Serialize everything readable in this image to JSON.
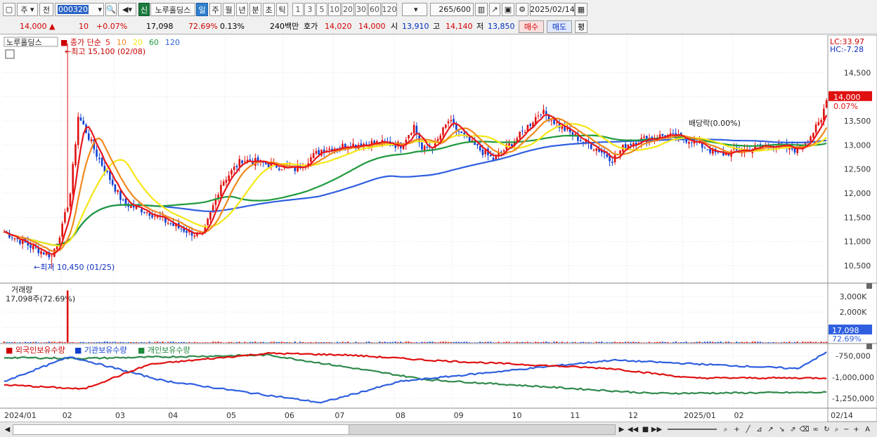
{
  "toolbar": {
    "market": "주",
    "type": "전",
    "code": "000320",
    "name": "노루홀딩스",
    "new_badge": "신",
    "periods": [
      "일",
      "주",
      "월",
      "년",
      "분",
      "초",
      "틱"
    ],
    "active_period": "일",
    "intervals": [
      "1",
      "3",
      "5",
      "10",
      "20",
      "30",
      "60",
      "120"
    ],
    "count": "265",
    "count_total": "/600",
    "date": "2025/02/14"
  },
  "quote": {
    "price": "14,000",
    "arrow": "▲",
    "change": "10",
    "change_pct": "+0.07%",
    "volume": "17,098",
    "volume_pct": "72.69%",
    "turnover_pct": "0.13%",
    "amount": "240백만",
    "ask_label": "호가",
    "ask1": "14,020",
    "ask2": "14,000",
    "open_label": "시",
    "open": "13,910",
    "high_label": "고",
    "high": "14,140",
    "low_label": "저",
    "low": "13,850",
    "buy_label": "매수",
    "sell_label": "매도",
    "eval_label": "평"
  },
  "legend": {
    "stock_name": "노루홀딩스",
    "series_label": "종가 단순",
    "ma_periods": [
      "5",
      "10",
      "20",
      "60",
      "120"
    ],
    "ma_colors": [
      "#e8171b",
      "#f08a1c",
      "#f5e616",
      "#1f9a3c",
      "#2f5fe0"
    ],
    "high_note": "←최고 15,100 (02/08)",
    "low_note": "←최저 10,450 (01/25)",
    "dividend_note": "배당락(0.00%)",
    "lc": "LC:33.97",
    "hc": "HC:-7.28",
    "last_price": "14,000",
    "last_pct": "0.07%"
  },
  "volume_panel": {
    "title": "거래량",
    "value_note": "17,098주(72.69%)",
    "last": "17,098",
    "last_pct": "72.69%"
  },
  "holdings_panel": {
    "foreign": "외국인보유수량",
    "inst": "기관보유수량",
    "indiv": "개인보유수량"
  },
  "chart_data": {
    "type": "candlestick",
    "price_ticks": [
      "14,500",
      "14,000",
      "13,500",
      "13,000",
      "12,500",
      "12,000",
      "11,500",
      "11,000",
      "10,500"
    ],
    "volume_ticks": [
      "3,000K",
      "2,000K",
      "1,000K"
    ],
    "holdings_ticks": [
      "-750,000",
      "-1,000,000",
      "-1,250,000"
    ],
    "x_ticks": [
      "2024/01",
      "02",
      "03",
      "04",
      "05",
      "06",
      "07",
      "08",
      "09",
      "10",
      "11",
      "12",
      "2025/01",
      "02",
      "02/14"
    ],
    "close_anchors": [
      [
        0,
        11200
      ],
      [
        10,
        10900
      ],
      [
        18,
        10700
      ],
      [
        22,
        11300
      ],
      [
        25,
        12000
      ],
      [
        28,
        13600
      ],
      [
        30,
        13400
      ],
      [
        35,
        12800
      ],
      [
        45,
        11800
      ],
      [
        55,
        11600
      ],
      [
        65,
        11300
      ],
      [
        75,
        11100
      ],
      [
        82,
        12200
      ],
      [
        90,
        12700
      ],
      [
        100,
        12600
      ],
      [
        110,
        12500
      ],
      [
        120,
        12900
      ],
      [
        130,
        13000
      ],
      [
        140,
        13050
      ],
      [
        150,
        13000
      ],
      [
        155,
        13400
      ],
      [
        158,
        12900
      ],
      [
        163,
        13000
      ],
      [
        168,
        13500
      ],
      [
        175,
        13100
      ],
      [
        185,
        12700
      ],
      [
        195,
        13200
      ],
      [
        203,
        13700
      ],
      [
        210,
        13400
      ],
      [
        218,
        13100
      ],
      [
        225,
        12900
      ],
      [
        230,
        12700
      ],
      [
        235,
        13000
      ],
      [
        240,
        13100
      ],
      [
        250,
        13200
      ],
      [
        260,
        13100
      ],
      [
        270,
        12800
      ],
      [
        280,
        12900
      ],
      [
        290,
        13000
      ],
      [
        300,
        12900
      ],
      [
        305,
        13200
      ],
      [
        309,
        13500
      ],
      [
        311,
        14000
      ]
    ],
    "volume_spike": {
      "index": 24,
      "value": 3400
    },
    "foreign_anchors": [
      [
        0,
        -1090000
      ],
      [
        30,
        -1140000
      ],
      [
        55,
        -850000
      ],
      [
        100,
        -720000
      ],
      [
        130,
        -740000
      ],
      [
        160,
        -800000
      ],
      [
        230,
        -900000
      ],
      [
        260,
        -1010000
      ],
      [
        311,
        -1010000
      ]
    ],
    "inst_anchors": [
      [
        0,
        -1050000
      ],
      [
        25,
        -760000
      ],
      [
        60,
        -1040000
      ],
      [
        120,
        -1300000
      ],
      [
        150,
        -1050000
      ],
      [
        230,
        -800000
      ],
      [
        300,
        -900000
      ],
      [
        311,
        -710000
      ]
    ],
    "indiv_anchors": [
      [
        0,
        -770000
      ],
      [
        30,
        -780000
      ],
      [
        100,
        -740000
      ],
      [
        160,
        -1030000
      ],
      [
        245,
        -1190000
      ],
      [
        311,
        -1180000
      ]
    ]
  }
}
